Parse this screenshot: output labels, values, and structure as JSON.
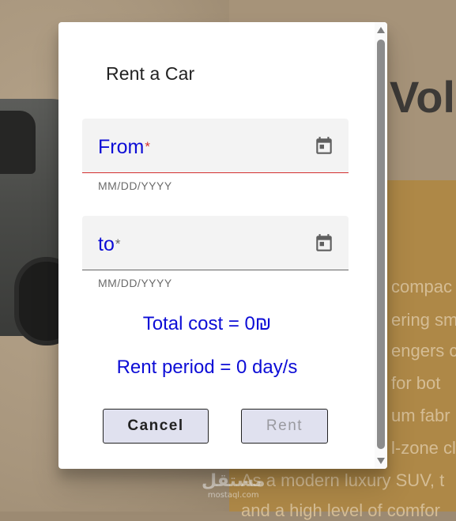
{
  "background": {
    "heading": "Vol",
    "description_lines": [
      "compac",
      "ering sm",
      "engers c",
      "for bot",
      "um fabr",
      "l-zone cl",
      "As a modern luxury SUV, t",
      "and a high level of comfor"
    ],
    "watermark": {
      "main": "مستقل",
      "sub": "mostaql.com"
    }
  },
  "dialog": {
    "title": "Rent a Car",
    "from_field": {
      "label": "From",
      "required_mark": "*",
      "hint": "MM/DD/YYYY",
      "icon": "calendar-icon"
    },
    "to_field": {
      "label": "to",
      "required_mark": "*",
      "hint": "MM/DD/YYYY",
      "icon": "calendar-icon"
    },
    "total_cost": "Total cost = 0₪",
    "rent_period": "Rent period = 0 day/s",
    "cancel_label": "Cancel",
    "rent_label": "Rent"
  },
  "colors": {
    "accent_text": "#0d0dd6",
    "error": "#d32f2f",
    "button_bg": "#e0e1ef"
  }
}
